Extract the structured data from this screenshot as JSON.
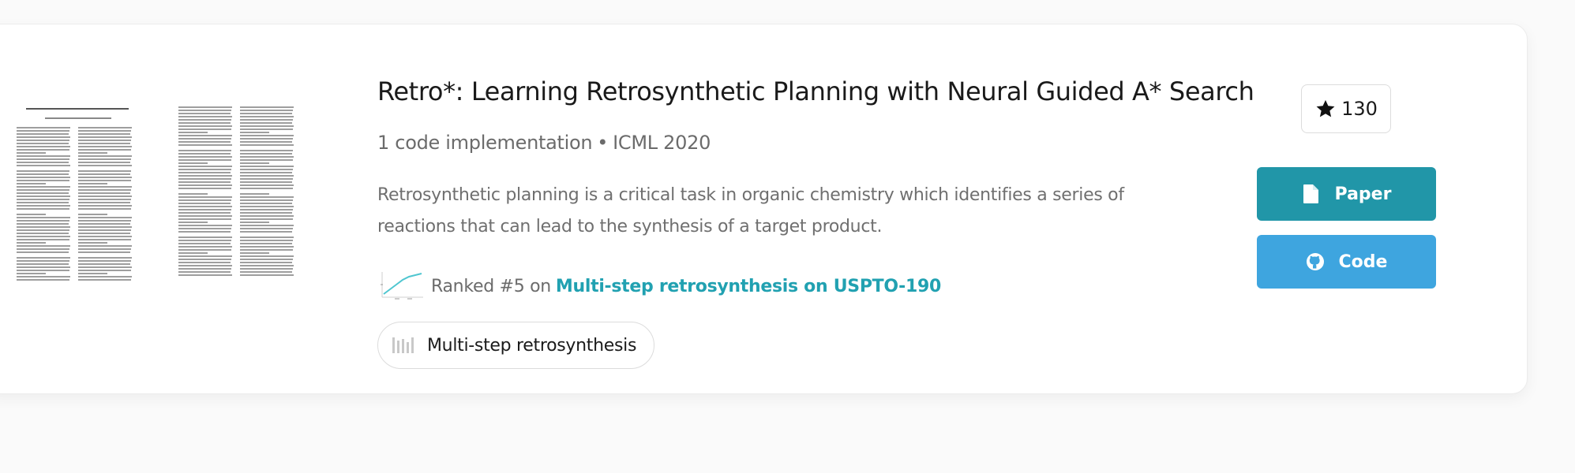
{
  "paper": {
    "title": "Retro*: Learning Retrosynthetic Planning with Neural Guided A* Search",
    "code_implementations": "1 code implementation",
    "separator": "•",
    "venue": "ICML 2020",
    "abstract": "Retrosynthetic planning is a critical task in organic chemistry which identifies a series of reactions that can lead to the synthesis of a target product.",
    "ranking": {
      "prefix": "Ranked #5 on",
      "benchmark": "Multi-step retrosynthesis on USPTO-190",
      "sparkline_icon": "sparkline-chart-icon"
    },
    "task": {
      "label": "Multi-step retrosynthesis",
      "icon": "task-bars-icon"
    }
  },
  "stars": {
    "icon": "star-icon",
    "count": "130"
  },
  "buttons": {
    "paper": {
      "label": "Paper",
      "icon": "document-icon",
      "color": "#2196a8"
    },
    "code": {
      "label": "Code",
      "icon": "github-icon",
      "color": "#3ea5df"
    }
  },
  "colors": {
    "accent_link": "#21a1b1",
    "text_muted": "#6f6f6f",
    "title": "#1a1a1a"
  }
}
